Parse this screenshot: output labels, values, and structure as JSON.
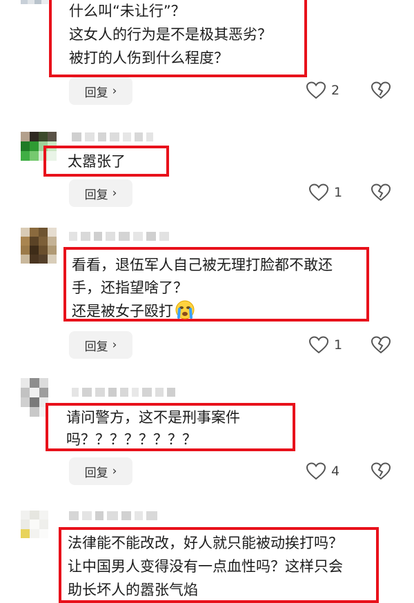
{
  "comments": [
    {
      "lines": [
        "什么叫“未让行”？",
        "这女人的行为是不是极其恶劣？",
        "被打的人伤到什么程度？"
      ],
      "reply_label": "回复",
      "likes": "2"
    },
    {
      "lines": [
        "太嚣张了"
      ],
      "reply_label": "回复",
      "likes": "1"
    },
    {
      "lines": [
        "看看，退伍军人自己被无理打脸都不敢还",
        "手，还指望啥了？",
        "还是被女子殴打"
      ],
      "reply_label": "回复",
      "likes": "1"
    },
    {
      "lines": [
        "请问警方，这不是刑事案件",
        "吗？？？？？？？？"
      ],
      "reply_label": "回复",
      "likes": "4"
    },
    {
      "lines": [
        "法律能不能改改，好人就只能被动挨打吗？",
        "让中国男人变得没有一点血性吗？这样只会",
        "助长坏人的嚣张气焰"
      ]
    }
  ],
  "icons": {
    "like": "heart-outline-icon",
    "dislike": "broken-heart-icon",
    "reply_chevron": "chevron-right-icon",
    "emoji": "crying-face-emoji"
  },
  "colors": {
    "highlight": "#e8111b",
    "reply_bg": "#f2f2f2",
    "text": "#1c1c1c"
  }
}
